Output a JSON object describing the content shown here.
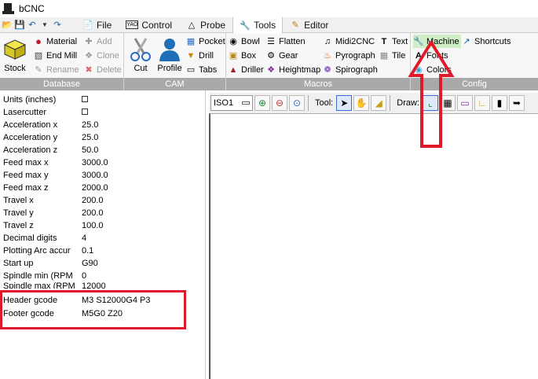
{
  "window": {
    "title": "bCNC"
  },
  "quick_access": [
    "open-icon",
    "save-icon",
    "undo-icon",
    "dropdown-icon",
    "redo-icon"
  ],
  "tabs": [
    {
      "label": "File",
      "icon": "file-icon",
      "active": false
    },
    {
      "label": "Control",
      "icon": "control-icon",
      "active": false
    },
    {
      "label": "Probe",
      "icon": "probe-icon",
      "active": false
    },
    {
      "label": "Tools",
      "icon": "tools-icon",
      "active": true
    },
    {
      "label": "Editor",
      "icon": "editor-icon",
      "active": false
    }
  ],
  "ribbon": {
    "database": {
      "label": "Database",
      "stock": "Stock",
      "material": "Material",
      "endmill": "End Mill",
      "rename": "Rename",
      "add": "Add",
      "clone": "Clone",
      "delete": "Delete"
    },
    "cam": {
      "label": "CAM",
      "cut": "Cut",
      "profile": "Profile",
      "pocket": "Pocket",
      "drill": "Drill",
      "tabs": "Tabs"
    },
    "macros": {
      "label": "Macros",
      "bowl": "Bowl",
      "flatten": "Flatten",
      "midi2cnc": "Midi2CNC",
      "text": "Text",
      "box": "Box",
      "gear": "Gear",
      "pyrograph": "Pyrograph",
      "tile": "Tile",
      "driller": "Driller",
      "heightmap": "Heightmap",
      "spirograph": "Spirograph"
    },
    "config": {
      "label": "Config",
      "machine": "Machine",
      "shortcuts": "Shortcuts",
      "fonts": "Fonts",
      "colors": "Colors"
    }
  },
  "properties": [
    {
      "key": "Units (inches)",
      "value": "",
      "checkbox": true
    },
    {
      "key": "Lasercutter",
      "value": "",
      "checkbox": true
    },
    {
      "key": "Acceleration x",
      "value": "25.0"
    },
    {
      "key": "Acceleration y",
      "value": "25.0"
    },
    {
      "key": "Acceleration z",
      "value": "50.0"
    },
    {
      "key": "Feed max x",
      "value": "3000.0"
    },
    {
      "key": "Feed max y",
      "value": "3000.0"
    },
    {
      "key": "Feed max z",
      "value": "2000.0"
    },
    {
      "key": "Travel x",
      "value": "200.0"
    },
    {
      "key": "Travel y",
      "value": "200.0"
    },
    {
      "key": "Travel z",
      "value": "100.0"
    },
    {
      "key": "Decimal digits",
      "value": "4"
    },
    {
      "key": "Plotting Arc accur",
      "value": "0.1"
    },
    {
      "key": "Start up",
      "value": "G90"
    },
    {
      "key": "Spindle min (RPM",
      "value": "0"
    },
    {
      "key": "Spindle max (RPM",
      "value": "12000"
    },
    {
      "key": "Header gcode",
      "value": "M3 S12000G4 P3"
    },
    {
      "key": "Footer gcode",
      "value": "M5G0 Z20"
    }
  ],
  "canvas_toolbar": {
    "view": "ISO1",
    "tool_label": "Tool:",
    "draw_label": "Draw:"
  },
  "annotation_color": "#e01a2b"
}
